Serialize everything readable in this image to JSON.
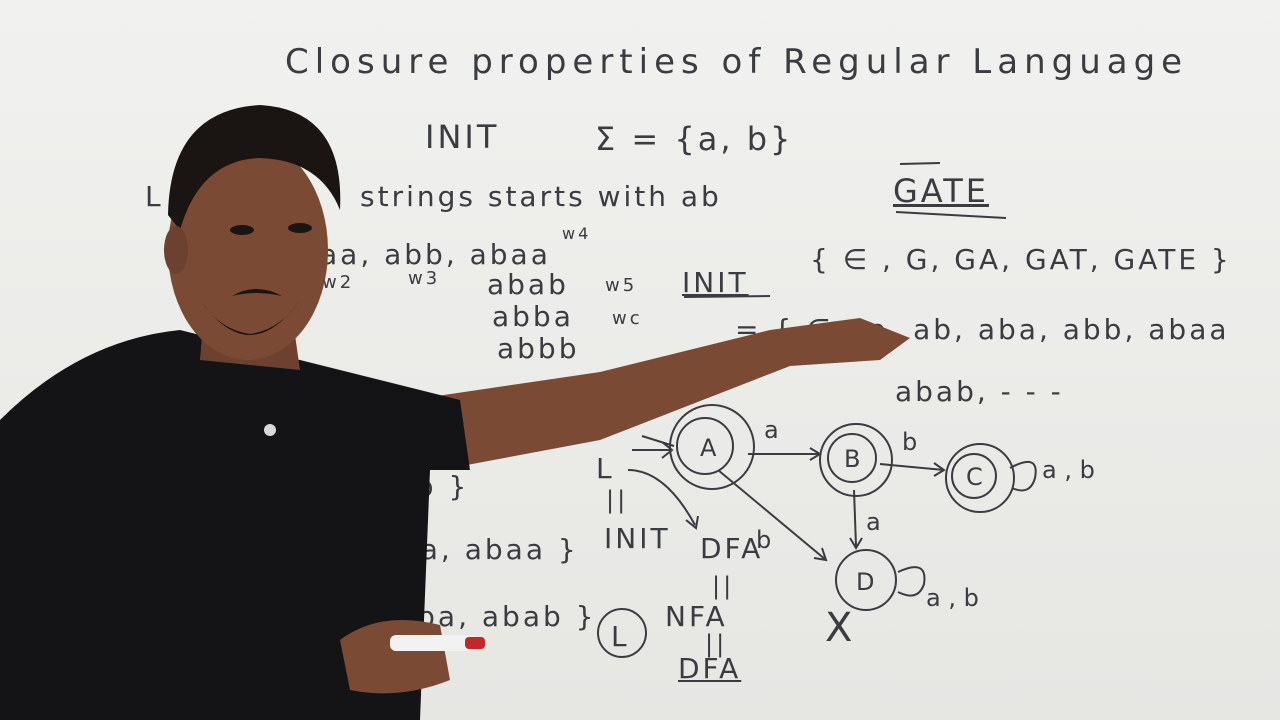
{
  "board": {
    "title": "Closure properties of Regular Language",
    "init_label": "INIT",
    "sigma": "Σ = {a, b}",
    "L_prefix": "L",
    "definition": "strings starts with ab",
    "strings_row1": "aa, abb, abaa",
    "w_labels": [
      "w4",
      "w2",
      "w3",
      "w5",
      "wc"
    ],
    "strings_col": [
      "abab",
      "abba",
      "abbb"
    ],
    "gate_word": "GATE",
    "gate_prefixes": "{ ∈ , G, GA, GAT, GATE }",
    "init_heading": "INIT",
    "init_set": "= { ∈ , a, ab, aba, abb, abaa",
    "init_set_cont": "abab, - - -",
    "dfa_states": [
      "A",
      "B",
      "C",
      "D"
    ],
    "dfa_edge_labels": [
      "a",
      "b",
      "b",
      "a",
      "a, b",
      "a, b"
    ],
    "left_lower": [
      "bb }",
      "ba, abaa }",
      "aba, abab }"
    ],
    "chain": [
      "L",
      "||",
      "INIT",
      "DFA",
      "||",
      "NFA",
      "||",
      "DFA"
    ],
    "circled_L": "L",
    "cross_mark": "X"
  },
  "colors": {
    "board": "#eeeeec",
    "ink": "#3a3c42",
    "shirt": "#141416",
    "skin": "#7a4a34",
    "hair": "#1a1412"
  }
}
